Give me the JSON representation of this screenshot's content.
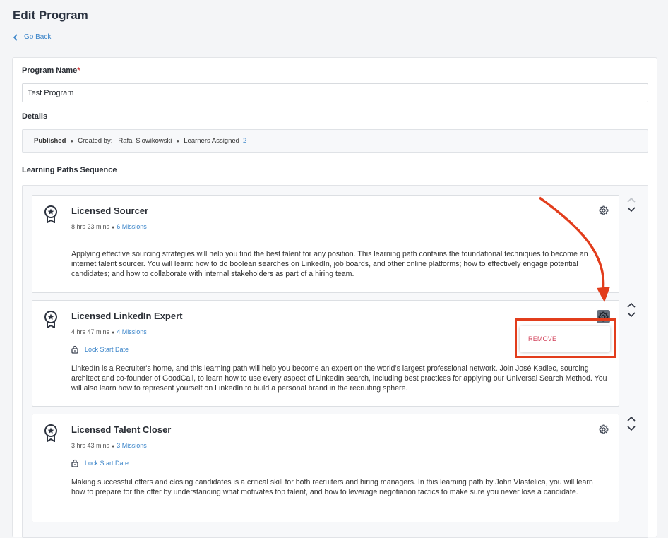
{
  "page": {
    "title": "Edit Program",
    "go_back_label": "Go Back"
  },
  "form": {
    "program_name_label": "Program Name",
    "required_marker": "*",
    "program_name_value": "Test Program",
    "details_label": "Details",
    "details": {
      "status": "Published",
      "created_by_label": "Created by:",
      "created_by_name": "Rafal Slowikowski",
      "learners_label": "Learners Assigned",
      "learners_count": "2"
    },
    "sequence_label": "Learning Paths Sequence"
  },
  "learning_paths": [
    {
      "title": "Licensed Sourcer",
      "duration": "8 hrs 23 mins",
      "missions": "6 Missions",
      "lock_label": "",
      "description": "Applying effective sourcing strategies will help you find the best talent for any position. This learning path contains the foundational techniques to become an internet talent sourcer. You will learn: how to do boolean searches on LinkedIn, job boards, and other online platforms; how to effectively engage potential candidates; and how to collaborate with internal stakeholders as part of a hiring team."
    },
    {
      "title": "Licensed LinkedIn Expert",
      "duration": "4 hrs 47 mins",
      "missions": "4 Missions",
      "lock_label": "Lock Start Date",
      "description": "LinkedIn is a Recruiter's home, and this learning path will help you become an expert on the world’s largest professional network. Join José Kadlec, sourcing architect and co-founder of GoodCall, to learn how to use every aspect of LinkedIn search, including best practices for applying our Universal Search Method. You will also learn how to represent yourself on LinkedIn to build a personal brand in the recruiting sphere."
    },
    {
      "title": "Licensed Talent Closer",
      "duration": "3 hrs 43 mins",
      "missions": "3 Missions",
      "lock_label": "Lock Start Date",
      "description": "Making successful offers and closing candidates is a critical skill for both recruiters and hiring managers. In this learning path by John Vlastelica, you will learn how to prepare for the offer by understanding what motivates top talent, and how to leverage negotiation tactics to make sure you never lose a candidate."
    }
  ],
  "context_menu": {
    "remove_label": "REMOVE"
  },
  "colors": {
    "link": "#3a84c9",
    "annotation": "#e23d1c",
    "remove": "#d2415a"
  }
}
